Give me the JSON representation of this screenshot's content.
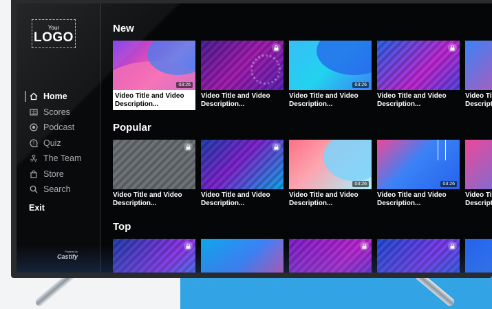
{
  "logo": {
    "small": "Your",
    "big": "LOGO"
  },
  "nav": [
    {
      "label": "Home",
      "icon": "home-icon",
      "active": true
    },
    {
      "label": "Scores",
      "icon": "scoreboard-icon",
      "active": false
    },
    {
      "label": "Podcast",
      "icon": "podcast-icon",
      "active": false
    },
    {
      "label": "Quiz",
      "icon": "quiz-icon",
      "active": false
    },
    {
      "label": "The Team",
      "icon": "team-icon",
      "active": false
    },
    {
      "label": "Store",
      "icon": "shopping-bag-icon",
      "active": false
    },
    {
      "label": "Search",
      "icon": "search-icon",
      "active": false
    }
  ],
  "exit_label": "Exit",
  "powered": {
    "line1": "Powered by",
    "line2": "Castify"
  },
  "rows": [
    {
      "title": "New",
      "tiles": [
        {
          "caption": "Video Title and Video Description...",
          "duration": "03:26",
          "locked": false,
          "focused": true
        },
        {
          "caption": "Video Title and Video Description...",
          "duration": "",
          "locked": true,
          "focused": false
        },
        {
          "caption": "Video Title and Video Description...",
          "duration": "03:26",
          "locked": false,
          "focused": false
        },
        {
          "caption": "Video Title and Video Description...",
          "duration": "",
          "locked": true,
          "focused": false
        },
        {
          "caption": "Video Title and Video Description...",
          "duration": "",
          "locked": false,
          "focused": false
        }
      ]
    },
    {
      "title": "Popular",
      "tiles": [
        {
          "caption": "Video Title and Video Description...",
          "duration": "",
          "locked": true,
          "focused": false
        },
        {
          "caption": "Video Title and Video Description...",
          "duration": "",
          "locked": true,
          "focused": false
        },
        {
          "caption": "Video Title and Video Description...",
          "duration": "03:26",
          "locked": false,
          "focused": false
        },
        {
          "caption": "Video Title and Video Description...",
          "duration": "03:26",
          "locked": false,
          "focused": false
        },
        {
          "caption": "Video Title and Video Description...",
          "duration": "",
          "locked": false,
          "focused": false
        }
      ]
    },
    {
      "title": "Top",
      "tiles": [
        {
          "caption": "",
          "duration": "",
          "locked": true,
          "focused": false
        },
        {
          "caption": "",
          "duration": "",
          "locked": false,
          "focused": false
        },
        {
          "caption": "",
          "duration": "",
          "locked": true,
          "focused": false
        },
        {
          "caption": "",
          "duration": "",
          "locked": true,
          "focused": false
        },
        {
          "caption": "",
          "duration": "",
          "locked": false,
          "focused": false
        }
      ]
    }
  ],
  "colors": {
    "accent": "#2f8bff",
    "screen": "#050607",
    "wall": "#3aa7e6"
  }
}
